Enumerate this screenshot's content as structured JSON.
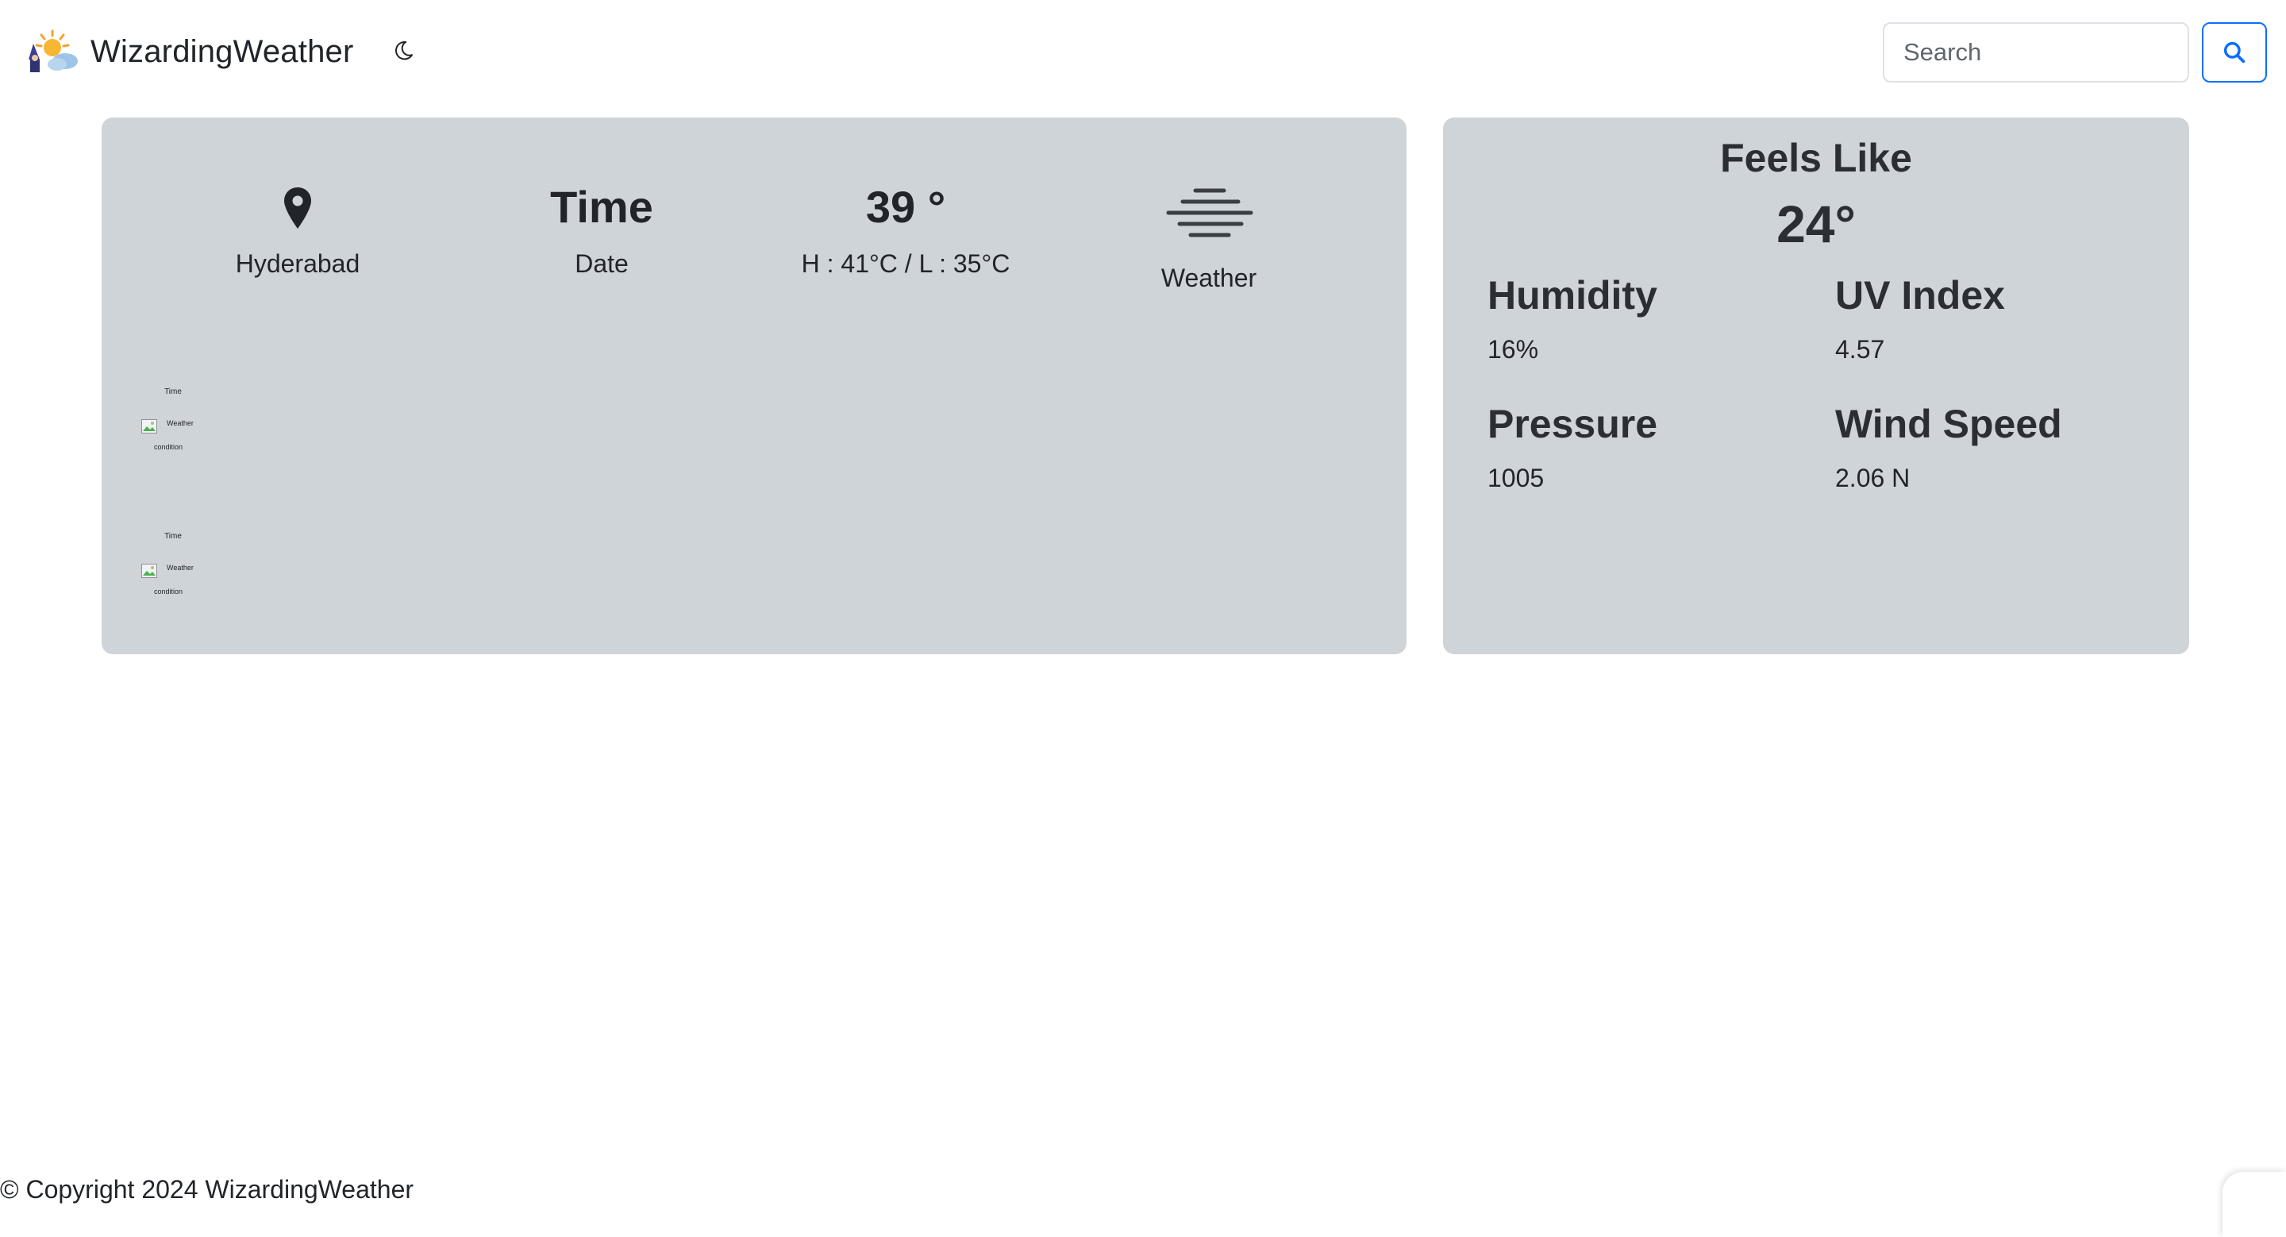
{
  "navbar": {
    "brand": "WizardingWeather",
    "logo_icon": "wizard-sun-cloud-logo",
    "theme_toggle_icon": "moon-icon",
    "search": {
      "placeholder": "Search",
      "value": "",
      "button_icon": "search-icon"
    }
  },
  "current": {
    "location_icon": "map-pin-icon",
    "city": "Hyderabad",
    "time": "Time",
    "date": "Date",
    "temperature": "39 °",
    "high_low": "H : 41°C / L : 35°C",
    "weather_icon": "fog-icon",
    "weather": "Weather"
  },
  "hourly": [
    {
      "time": "Time",
      "alt_line1": "Weather",
      "alt_line2": "condition"
    },
    {
      "time": "Time",
      "alt_line1": "Weather",
      "alt_line2": "condition"
    }
  ],
  "details": {
    "feels_like_label": "Feels Like",
    "feels_like_value": "24°",
    "humidity_label": "Humidity",
    "humidity_value": "16%",
    "uv_label": "UV Index",
    "uv_value": "4.57",
    "pressure_label": "Pressure",
    "pressure_value": "1005",
    "wind_label": "Wind Speed",
    "wind_value": "2.06 N"
  },
  "footer": {
    "copyright": "© Copyright 2024 WizardingWeather"
  },
  "colors": {
    "card_bg": "#cfd4d9",
    "accent": "#0d6efd",
    "text": "#212529"
  }
}
